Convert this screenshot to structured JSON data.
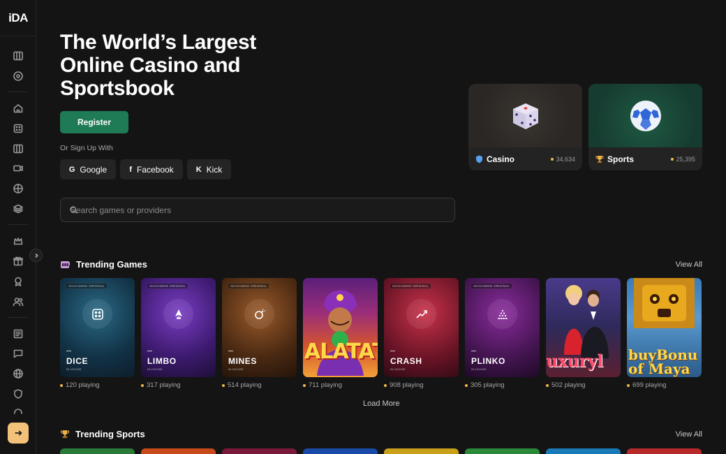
{
  "brand": {
    "logo_main": "iDA"
  },
  "hero": {
    "title": "The World’s Largest Online Casino and Sportsbook",
    "register_label": "Register",
    "signup_label": "Or Sign Up With",
    "socials": [
      {
        "glyph": "G",
        "label": "Google"
      },
      {
        "glyph": "f",
        "label": "Facebook"
      },
      {
        "glyph": "K",
        "label": "Kick"
      }
    ]
  },
  "search": {
    "placeholder": "Search games or providers"
  },
  "categories": [
    {
      "name": "Casino",
      "count": "34,634",
      "icon": "shield-icon"
    },
    {
      "name": "Sports",
      "count": "25,395",
      "icon": "trophy-icon"
    }
  ],
  "trending_games": {
    "title": "Trending Games",
    "view_all": "View All",
    "load_more": "Load More",
    "games": [
      {
        "name": "DICE",
        "badge": "IDAGAMING ORIGINAL",
        "sub": "IN-HOUSE",
        "playing": "120 playing"
      },
      {
        "name": "LIMBO",
        "badge": "IDAGAMING ORIGINAL",
        "sub": "IN-HOUSE",
        "playing": "317 playing"
      },
      {
        "name": "MINES",
        "badge": "IDAGAMING ORIGINAL",
        "sub": "IN-HOUSE",
        "playing": "514 playing"
      },
      {
        "name": "ALATAT",
        "playing": "711 playing"
      },
      {
        "name": "CRASH",
        "badge": "IDAGAMING ORIGINAL",
        "sub": "IN-HOUSE",
        "playing": "908 playing"
      },
      {
        "name": "PLINKO",
        "badge": "IDAGAMING ORIGINAL",
        "sub": "IN-HOUSE",
        "playing": "305 playing"
      },
      {
        "name": "uxuryl",
        "playing": "502 playing"
      },
      {
        "name": "buyBonu of Maya",
        "playing": "699 playing"
      }
    ]
  },
  "trending_sports": {
    "title": "Trending Sports",
    "view_all": "View All"
  },
  "colors": {
    "accent_green": "#1f7a56",
    "login_yellow": "#f2c27a",
    "dot_yellow": "#f2b84b"
  }
}
